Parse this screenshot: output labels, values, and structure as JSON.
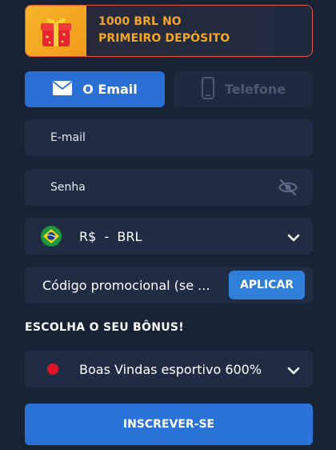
{
  "banner": {
    "line1": "1000 BRL NO",
    "line2": "PRIMEIRO DEPÓSITO",
    "icon": "gift-icon",
    "accent_color": "#f5a623",
    "border_color": "#e8503a"
  },
  "tabs": [
    {
      "label": "O Email",
      "icon": "envelope-icon",
      "active": true
    },
    {
      "label": "Telefone",
      "icon": "phone-icon",
      "active": false
    }
  ],
  "form": {
    "email_label": "E-mail",
    "password_label": "Senha",
    "password_toggle_icon": "eye-off-icon",
    "currency": {
      "value": "R$  -  BRL",
      "flag": "brazil-flag-icon"
    },
    "promo": {
      "placeholder": "Código promocional (se ...",
      "button_label": "APLICAR"
    }
  },
  "bonus": {
    "section_title": "ESCOLHA O SEU BÔNUS!",
    "selected": "Boas Vindas esportivo 600%",
    "indicator_color": "#e0142b"
  },
  "submit_label": "INSCREVER-SE",
  "colors": {
    "background": "#172235",
    "field": "#1f2c44",
    "primary": "#2b73d8"
  }
}
